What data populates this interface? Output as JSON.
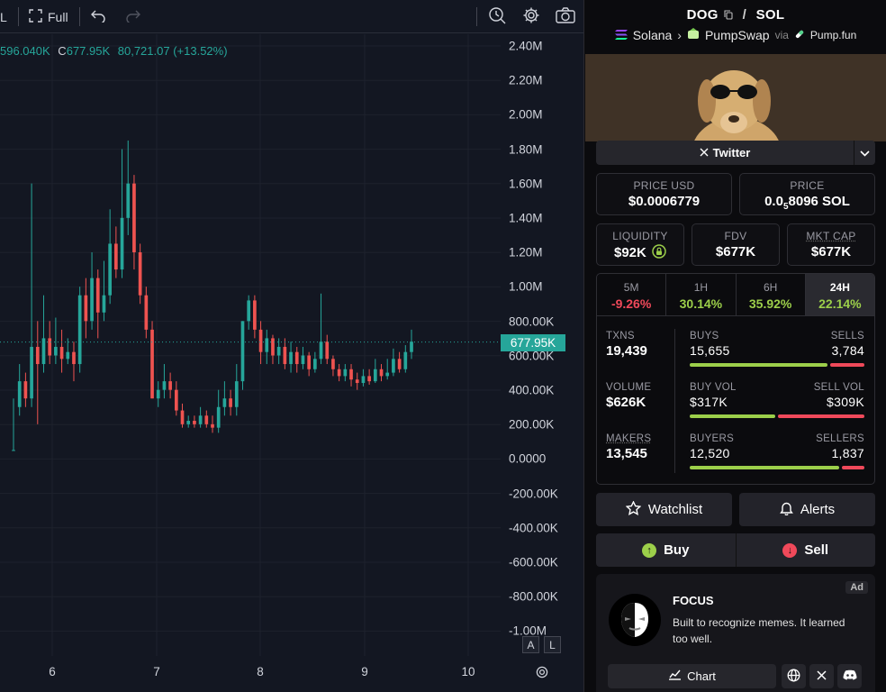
{
  "toolbar": {
    "interval_label": "L",
    "full_label": "Full"
  },
  "legend": {
    "low_value": "596.040K",
    "close_label": "C",
    "close_value": "677.95K",
    "change": "80,721.07 (+13.52%)"
  },
  "price_scale": [
    "2.40M",
    "2.20M",
    "2.00M",
    "1.80M",
    "1.60M",
    "1.40M",
    "1.20M",
    "1.00M",
    "800.00K",
    "600.00K",
    "400.00K",
    "200.00K",
    "0.0000",
    "-200.00K",
    "-400.00K",
    "-600.00K",
    "-800.00K",
    "-1.00M"
  ],
  "current_price_label": "677.95K",
  "time_scale": [
    "6",
    "7",
    "8",
    "9",
    "10"
  ],
  "scale_buttons": {
    "auto": "A",
    "log": "L"
  },
  "chart_data": {
    "type": "candlestick",
    "x_ticks": [
      "6",
      "7",
      "8",
      "9",
      "10"
    ],
    "y_range": [
      -1000000,
      2400000
    ],
    "last_close": 677950,
    "candles": [
      [
        0.05,
        0.05,
        0.35,
        0.05,
        0.05
      ],
      [
        0.3,
        0.45,
        0.55,
        0.25,
        0.45
      ],
      [
        0.45,
        0.35,
        0.5,
        0.3,
        0.35
      ],
      [
        0.35,
        1.55,
        1.6,
        0.3,
        0.65
      ],
      [
        0.65,
        0.55,
        0.8,
        0.2,
        0.55
      ],
      [
        0.55,
        0.75,
        0.95,
        0.5,
        0.7
      ],
      [
        0.7,
        0.6,
        0.8,
        0.55,
        0.6
      ],
      [
        0.6,
        0.7,
        0.82,
        0.55,
        0.65
      ],
      [
        0.65,
        0.58,
        0.75,
        0.5,
        0.58
      ],
      [
        0.58,
        0.62,
        0.7,
        0.55,
        0.62
      ],
      [
        0.62,
        0.55,
        0.68,
        0.45,
        0.55
      ],
      [
        0.55,
        0.7,
        1.0,
        0.5,
        0.95
      ],
      [
        0.95,
        0.8,
        1.05,
        0.7,
        0.8
      ],
      [
        0.8,
        1.1,
        1.2,
        0.75,
        1.05
      ],
      [
        1.05,
        0.85,
        1.1,
        0.7,
        0.85
      ],
      [
        0.85,
        1.0,
        1.15,
        0.8,
        0.95
      ],
      [
        0.95,
        1.25,
        1.45,
        0.9,
        1.25
      ],
      [
        1.25,
        1.1,
        1.35,
        1.05,
        1.1
      ],
      [
        1.1,
        1.45,
        1.8,
        1.05,
        1.4
      ],
      [
        1.4,
        1.65,
        1.85,
        1.3,
        1.6
      ],
      [
        1.6,
        1.2,
        1.65,
        1.1,
        1.2
      ],
      [
        1.2,
        0.95,
        1.25,
        0.9,
        0.95
      ],
      [
        0.95,
        0.75,
        1.0,
        0.7,
        0.75
      ],
      [
        0.75,
        0.55,
        0.8,
        0.35,
        0.35
      ],
      [
        0.35,
        0.4,
        0.45,
        0.3,
        0.4
      ],
      [
        0.4,
        0.45,
        0.55,
        0.35,
        0.45
      ],
      [
        0.45,
        0.4,
        0.5,
        0.35,
        0.4
      ],
      [
        0.4,
        0.28,
        0.45,
        0.25,
        0.28
      ],
      [
        0.28,
        0.2,
        0.32,
        0.18,
        0.2
      ],
      [
        0.2,
        0.22,
        0.25,
        0.18,
        0.22
      ],
      [
        0.22,
        0.2,
        0.25,
        0.18,
        0.2
      ],
      [
        0.2,
        0.25,
        0.3,
        0.18,
        0.25
      ],
      [
        0.25,
        0.2,
        0.28,
        0.18,
        0.2
      ],
      [
        0.2,
        0.18,
        0.25,
        0.15,
        0.18
      ],
      [
        0.18,
        0.3,
        0.4,
        0.15,
        0.3
      ],
      [
        0.3,
        0.35,
        0.45,
        0.25,
        0.35
      ],
      [
        0.35,
        0.3,
        0.4,
        0.25,
        0.3
      ],
      [
        0.3,
        0.45,
        0.55,
        0.25,
        0.45
      ],
      [
        0.45,
        0.55,
        0.8,
        0.4,
        0.8
      ],
      [
        0.8,
        0.92,
        0.95,
        0.75,
        0.92
      ],
      [
        0.92,
        0.75,
        0.95,
        0.7,
        0.75
      ],
      [
        0.75,
        0.62,
        0.8,
        0.55,
        0.62
      ],
      [
        0.62,
        0.7,
        0.75,
        0.55,
        0.7
      ],
      [
        0.7,
        0.6,
        0.72,
        0.55,
        0.6
      ],
      [
        0.6,
        0.65,
        0.7,
        0.55,
        0.65
      ],
      [
        0.65,
        0.55,
        0.7,
        0.52,
        0.55
      ],
      [
        0.55,
        0.62,
        0.68,
        0.5,
        0.62
      ],
      [
        0.62,
        0.55,
        0.65,
        0.5,
        0.55
      ],
      [
        0.55,
        0.6,
        0.65,
        0.52,
        0.6
      ],
      [
        0.6,
        0.52,
        0.62,
        0.48,
        0.52
      ],
      [
        0.52,
        0.58,
        0.62,
        0.5,
        0.58
      ],
      [
        0.58,
        0.7,
        0.96,
        0.55,
        0.68
      ],
      [
        0.68,
        0.58,
        0.72,
        0.55,
        0.58
      ],
      [
        0.58,
        0.52,
        0.6,
        0.48,
        0.52
      ],
      [
        0.52,
        0.48,
        0.55,
        0.45,
        0.48
      ],
      [
        0.48,
        0.52,
        0.55,
        0.45,
        0.52
      ],
      [
        0.52,
        0.46,
        0.55,
        0.42,
        0.46
      ],
      [
        0.46,
        0.44,
        0.5,
        0.4,
        0.44
      ],
      [
        0.44,
        0.48,
        0.52,
        0.42,
        0.48
      ],
      [
        0.48,
        0.45,
        0.52,
        0.43,
        0.45
      ],
      [
        0.45,
        0.52,
        0.58,
        0.44,
        0.52
      ],
      [
        0.52,
        0.48,
        0.55,
        0.45,
        0.48
      ],
      [
        0.48,
        0.5,
        0.58,
        0.46,
        0.5
      ],
      [
        0.5,
        0.55,
        0.64,
        0.48,
        0.58
      ],
      [
        0.58,
        0.52,
        0.62,
        0.5,
        0.52
      ],
      [
        0.52,
        0.62,
        0.66,
        0.5,
        0.62
      ],
      [
        0.62,
        0.68,
        0.75,
        0.58,
        0.68
      ]
    ]
  },
  "pair": {
    "base": "DOG",
    "quote": "SOL"
  },
  "breadcrumbs": {
    "chain": "Solana",
    "dex": "PumpSwap",
    "via": "via",
    "launchpad": "Pump.fun"
  },
  "twitter_label": "Twitter",
  "price": {
    "usd_label": "PRICE USD",
    "usd_value": "$0.0006779",
    "native_label": "PRICE",
    "native_prefix": "0.0",
    "native_sub": "5",
    "native_rest": "8096 SOL"
  },
  "metrics": {
    "liquidity_label": "LIQUIDITY",
    "liquidity_value": "$92K",
    "fdv_label": "FDV",
    "fdv_value": "$677K",
    "mcap_label": "MKT CAP",
    "mcap_value": "$677K"
  },
  "timeframes": [
    {
      "label": "5M",
      "value": "-9.26%"
    },
    {
      "label": "1H",
      "value": "30.14%"
    },
    {
      "label": "6H",
      "value": "35.92%"
    },
    {
      "label": "24H",
      "value": "22.14%"
    }
  ],
  "stats": {
    "txns_label": "TXNS",
    "txns_value": "19,439",
    "volume_label": "VOLUME",
    "volume_value": "$626K",
    "makers_label": "MAKERS",
    "makers_value": "13,545",
    "buys_label": "BUYS",
    "sells_label": "SELLS",
    "buys_value": "15,655",
    "sells_value": "3,784",
    "buys_fraction": 0.805,
    "buyvol_label": "BUY VOL",
    "sellvol_label": "SELL VOL",
    "buyvol_value": "$317K",
    "sellvol_value": "$309K",
    "buyvol_fraction": 0.506,
    "buyers_label": "BUYERS",
    "sellers_label": "SELLERS",
    "buyers_value": "12,520",
    "sellers_value": "1,837",
    "buyers_fraction": 0.872
  },
  "actions": {
    "watchlist": "Watchlist",
    "alerts": "Alerts",
    "buy": "Buy",
    "sell": "Sell"
  },
  "ad": {
    "badge": "Ad",
    "title": "FOCUS",
    "description": "Built to recognize memes. It learned too well.",
    "chart_label": "Chart"
  },
  "colors": {
    "up": "#26a69a",
    "down": "#ef5350",
    "positive": "#9ccf4a",
    "negative": "#f0495a"
  }
}
